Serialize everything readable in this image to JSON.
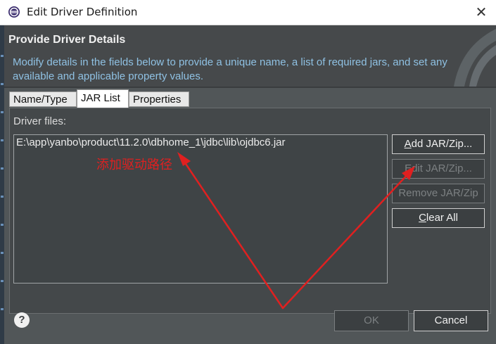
{
  "window": {
    "title": "Edit Driver Definition",
    "close_glyph": "✕"
  },
  "header": {
    "title": "Provide Driver Details",
    "description": "Modify details in the fields below to provide a unique name, a list of required jars, and set any available and applicable property values."
  },
  "tabs": [
    {
      "label": "Name/Type",
      "active": false
    },
    {
      "label": "JAR List",
      "active": true
    },
    {
      "label": "Properties",
      "active": false
    }
  ],
  "jar_list": {
    "label": "Driver files:",
    "files": [
      "E:\\app\\yanbo\\product\\11.2.0\\dbhome_1\\jdbc\\lib\\ojdbc6.jar"
    ],
    "buttons": {
      "add": {
        "label_prefix": "",
        "mnemonic": "A",
        "label_rest": "dd JAR/Zip...",
        "enabled": true
      },
      "edit": {
        "label": "Edit JAR/Zip...",
        "enabled": false
      },
      "remove": {
        "label": "Remove JAR/Zip",
        "enabled": false
      },
      "clear": {
        "label_prefix": "",
        "mnemonic": "C",
        "label_rest": "lear All",
        "enabled": true
      }
    }
  },
  "annotation": {
    "text": "添加驱动路径",
    "color": "#e02020"
  },
  "footer": {
    "help_glyph": "?",
    "ok_label": "OK",
    "ok_enabled": false,
    "cancel_label": "Cancel"
  },
  "colors": {
    "dialog_bg": "#515658",
    "header_bg": "#46494b",
    "description_text": "#8fc1e3",
    "annotation_red": "#e02020"
  }
}
